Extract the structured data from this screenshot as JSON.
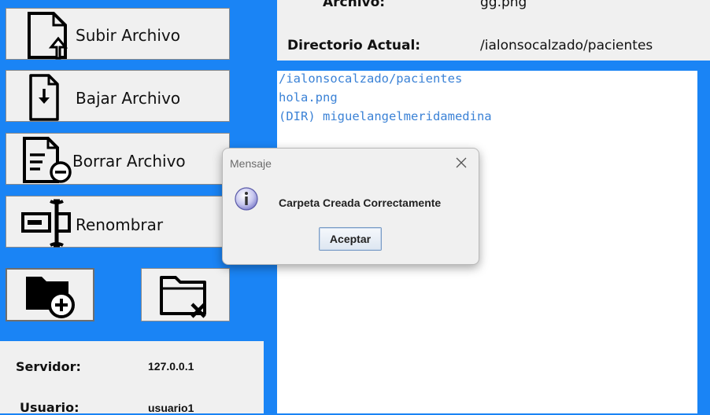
{
  "buttons": {
    "upload_label": "Subir Archivo",
    "download_label": "Bajar Archivo",
    "delete_label": "Borrar Archivo",
    "rename_label": "Renombrar"
  },
  "info": {
    "file_key": "Archivo:",
    "file_value": "gg.png",
    "dir_key": "Directorio Actual:",
    "dir_value": "/ialonsocalzado/pacientes"
  },
  "listing": {
    "rows": [
      "/ialonsocalzado/pacientes",
      "hola.png",
      "(DIR) miguelangelmeridamedina"
    ]
  },
  "connection": {
    "server_key": "Servidor:",
    "server_value": "127.0.0.1",
    "user_key": "Usuario:",
    "user_value": "usuario1"
  },
  "dialog": {
    "title": "Mensaje",
    "message": "Carpeta Creada Correctamente",
    "ok_label": "Aceptar",
    "icon": "information-icon"
  },
  "icons": {
    "upload": "file-upload-icon",
    "download": "file-download-icon",
    "delete": "file-remove-icon",
    "rename": "rename-icon",
    "new_folder": "folder-add-icon",
    "delete_folder": "folder-delete-icon"
  },
  "colors": {
    "background": "#1a84f5",
    "listing_text": "#3b82d6",
    "panel": "#f0f0f0"
  }
}
